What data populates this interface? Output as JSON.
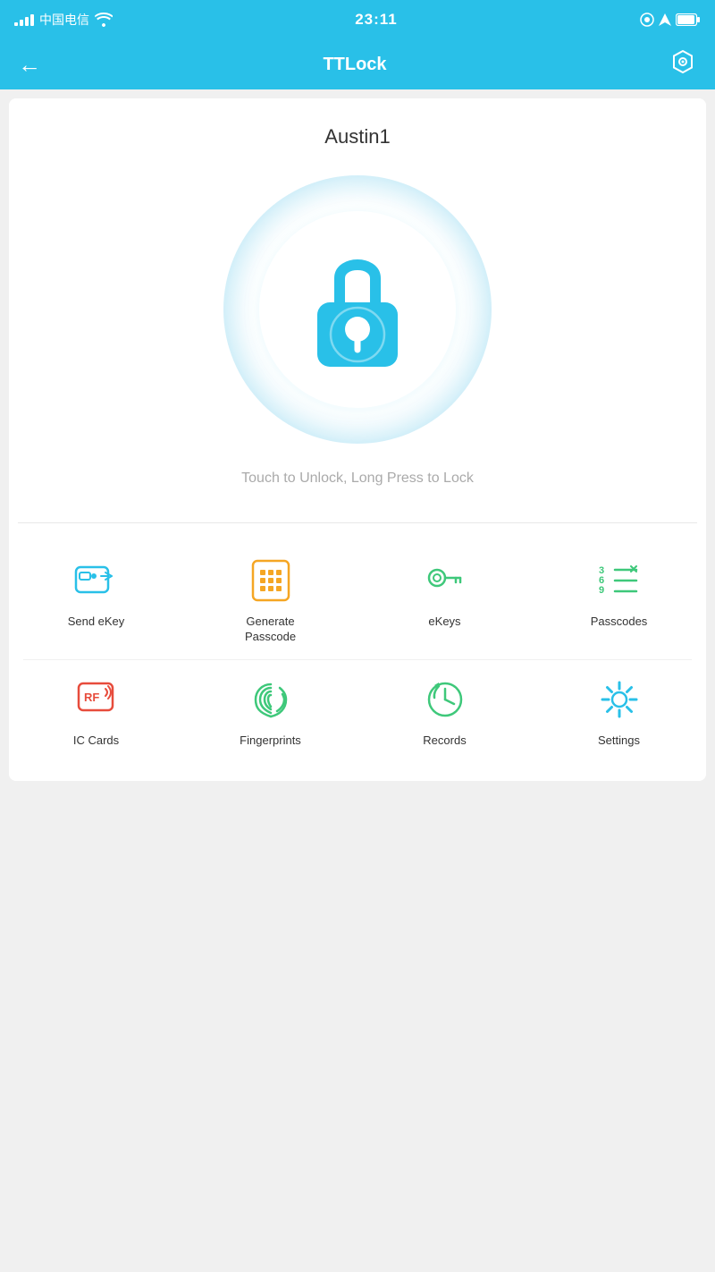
{
  "statusBar": {
    "carrier": "中国电信",
    "time": "23:11",
    "wifi": true
  },
  "navBar": {
    "title": "TTLock",
    "backLabel": "←"
  },
  "lockSection": {
    "deviceName": "Austin1",
    "hint": "Touch to Unlock, Long Press to Lock"
  },
  "actions": {
    "row1": [
      {
        "id": "send-ekey",
        "label": "Send eKey",
        "color": "#29c0e8"
      },
      {
        "id": "generate-passcode",
        "label": "Generate\nPasscode",
        "color": "#f5a623"
      },
      {
        "id": "ekeys",
        "label": "eKeys",
        "color": "#3ec87a"
      },
      {
        "id": "passcodes",
        "label": "Passcodes",
        "color": "#3ec87a"
      }
    ],
    "row2": [
      {
        "id": "ic-cards",
        "label": "IC Cards",
        "color": "#e74c3c"
      },
      {
        "id": "fingerprints",
        "label": "Fingerprints",
        "color": "#3ec87a"
      },
      {
        "id": "records",
        "label": "Records",
        "color": "#3ec87a"
      },
      {
        "id": "settings",
        "label": "Settings",
        "color": "#29c0e8"
      }
    ]
  }
}
